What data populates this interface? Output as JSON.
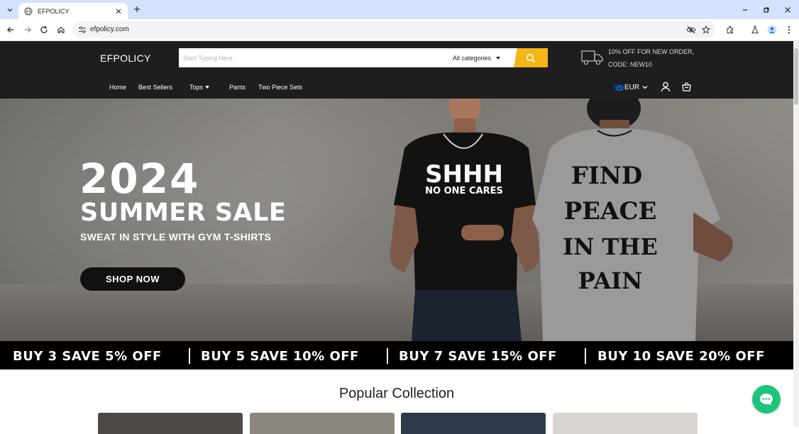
{
  "browser": {
    "tab_title": "EFPOLICY",
    "url": "efpolicy.com"
  },
  "site": {
    "logo": "EFPOLICY",
    "search": {
      "placeholder": "Start Typing Here",
      "category": "All categories"
    },
    "promo": {
      "line1": "10% OFF FOR NEW ORDER,",
      "line2": "CODE: NEW10"
    },
    "nav": [
      "Home",
      "Best Sellers",
      "Tops",
      "Pants",
      "Two Piece Sets"
    ],
    "currency": "EUR"
  },
  "hero": {
    "year": "2024",
    "title": "SUMMER SALE",
    "subtitle": "SWEAT IN STYLE WITH GYM T-SHIRTS",
    "cta": "SHOP NOW",
    "shirt1_line1": "SHHH",
    "shirt1_line2": "NO ONE CARES",
    "shirt2_lines": [
      "FIND",
      "PEACE",
      "IN THE",
      "PAIN"
    ]
  },
  "offers": [
    "BUY 3 SAVE 5% OFF",
    "BUY 5 SAVE 10% OFF",
    "BUY 7 SAVE 15% OFF",
    "BUY 10 SAVE 20% OFF"
  ],
  "popular": {
    "title": "Popular Collection"
  },
  "colors": {
    "header_bg": "#1e1e1e",
    "search_accent": "#f5b619",
    "chat_bubble": "#1ec47a"
  },
  "icons": {
    "search": "search-icon",
    "truck": "truck-icon",
    "account": "user-icon",
    "cart": "cart-icon",
    "chat": "chat-icon"
  }
}
